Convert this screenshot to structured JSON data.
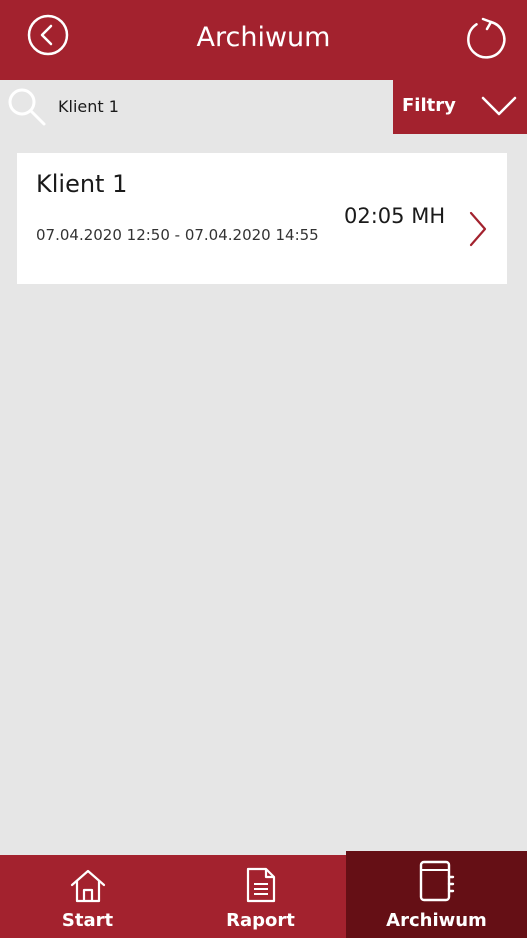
{
  "header": {
    "title": "Archiwum",
    "back_icon": "chevron-left-circle-icon",
    "refresh_icon": "refresh-icon"
  },
  "search": {
    "value": "Klient 1",
    "icon": "search-icon"
  },
  "filters": {
    "label": "Filtry",
    "icon": "chevron-down-icon"
  },
  "records": [
    {
      "client": "Klient 1",
      "dates": "07.04.2020 12:50 - 07.04.2020 14:55",
      "duration": "02:05 MH"
    }
  ],
  "bottom_nav": {
    "items": [
      {
        "label": "Start",
        "icon": "home-icon"
      },
      {
        "label": "Raport",
        "icon": "document-icon"
      },
      {
        "label": "Archiwum",
        "icon": "notebook-icon",
        "active": true
      }
    ]
  },
  "colors": {
    "primary": "#a3222e",
    "active_tab": "#650f15",
    "background": "#e6e6e6"
  }
}
